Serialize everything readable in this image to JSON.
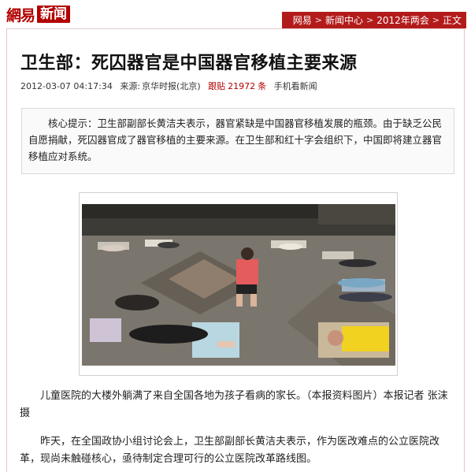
{
  "brand": {
    "netease": "網易",
    "news": "新闻"
  },
  "breadcrumb": [
    "网易",
    "新闻中心",
    "2012年两会",
    "正文"
  ],
  "article": {
    "title": "卫生部：死囚器官是中国器官移植主要来源",
    "datetime": "2012-03-07 04:17:34",
    "source_label": "来源:",
    "source": "京华时报(北京)",
    "follow_label": "跟贴",
    "follow_count": "21972",
    "follow_unit": "条",
    "mobile_link": "手机看新闻",
    "summary": "核心提示：卫生部副部长黄洁夫表示，器官紧缺是中国器官移植发展的瓶颈。由于缺乏公民自愿捐献，死囚器官成了器官移植的主要来源。在卫生部和红十字会组织下，中国即将建立器官移植应对系统。",
    "photo_caption": "儿童医院的大楼外躺满了来自全国各地为孩子看病的家长。（本报资料图片）本报记者 张沫 摄",
    "paragraph_2": "昨天，在全国政协小组讨论会上，卫生部副部长黄洁夫表示，作为医改难点的公立医院改革，现尚未触碰核心，亟待制定合理可行的公立医院改革路线图。"
  },
  "colors": {
    "brand_red": "#b20000",
    "crumb_bg": "#b31b1b"
  }
}
